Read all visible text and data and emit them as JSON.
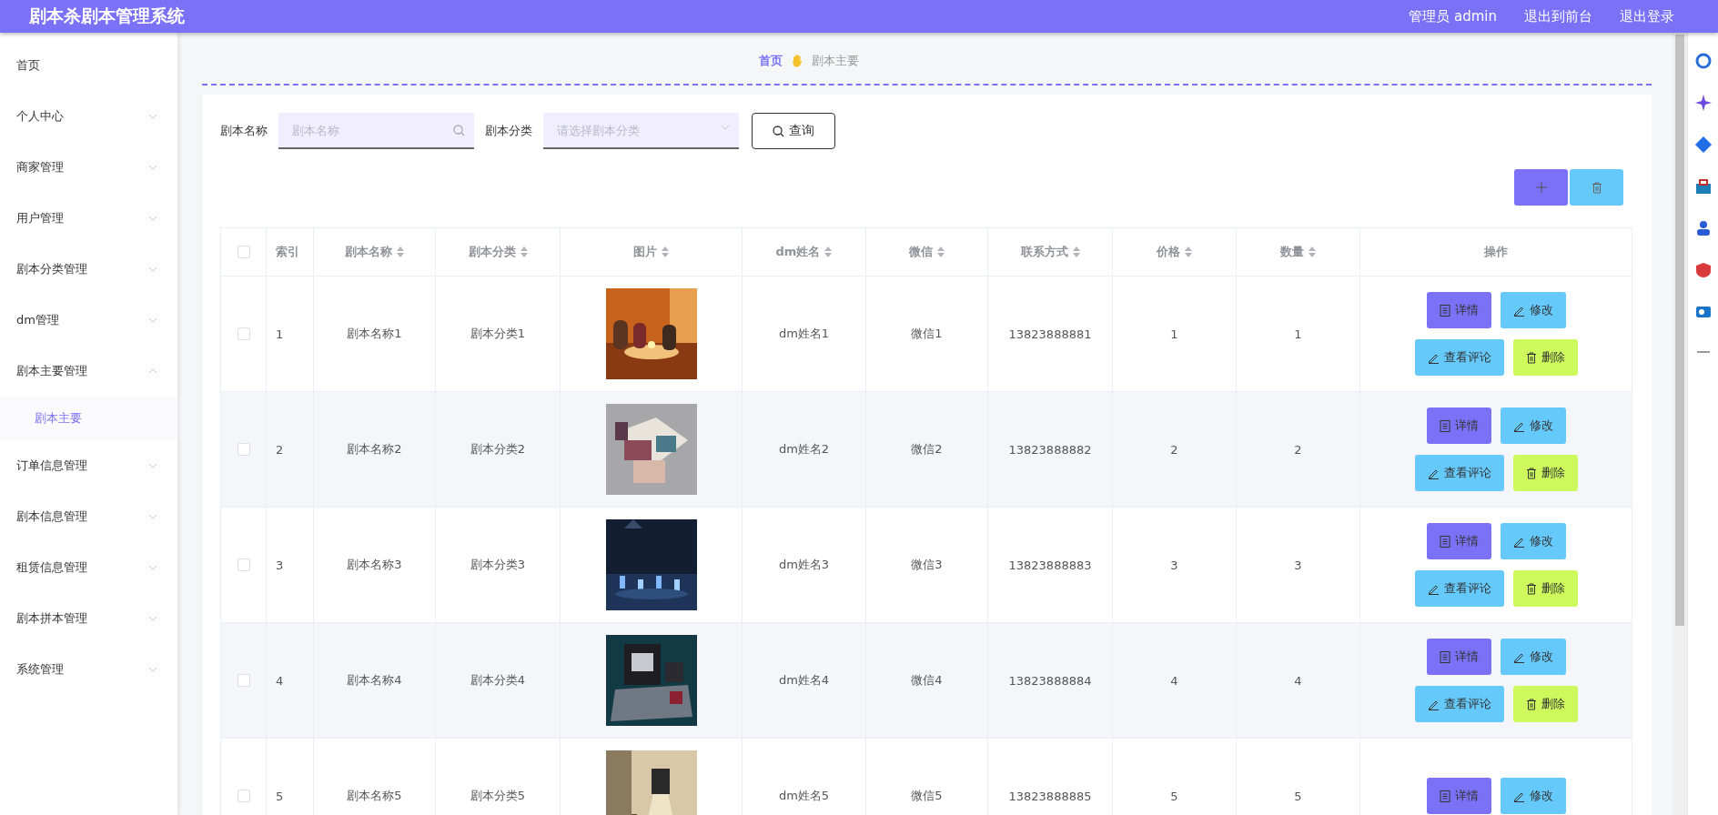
{
  "header": {
    "title": "剧本杀剧本管理系统",
    "links": [
      {
        "label": "管理员 admin"
      },
      {
        "label": "退出到前台"
      },
      {
        "label": "退出登录"
      }
    ]
  },
  "sidebar": {
    "items": [
      {
        "label": "首页",
        "kind": "link"
      },
      {
        "label": "个人中心",
        "kind": "menu",
        "expanded": false
      },
      {
        "label": "商家管理",
        "kind": "menu",
        "expanded": false
      },
      {
        "label": "用户管理",
        "kind": "menu",
        "expanded": false
      },
      {
        "label": "剧本分类管理",
        "kind": "menu",
        "expanded": false
      },
      {
        "label": "dm管理",
        "kind": "menu",
        "expanded": false
      },
      {
        "label": "剧本主要管理",
        "kind": "menu",
        "expanded": true,
        "children": [
          {
            "label": "剧本主要",
            "selected": true
          }
        ]
      },
      {
        "label": "订单信息管理",
        "kind": "menu",
        "expanded": false
      },
      {
        "label": "剧本信息管理",
        "kind": "menu",
        "expanded": false
      },
      {
        "label": "租赁信息管理",
        "kind": "menu",
        "expanded": false
      },
      {
        "label": "剧本拼本管理",
        "kind": "menu",
        "expanded": false
      },
      {
        "label": "系统管理",
        "kind": "menu",
        "expanded": false
      }
    ]
  },
  "breadcrumb": [
    {
      "label": "首页",
      "selected": false
    },
    {
      "label": "剧本主要",
      "selected": true
    }
  ],
  "search": {
    "fields": [
      {
        "label": "剧本名称",
        "placeholder": "剧本名称",
        "kind": "text"
      },
      {
        "label": "剧本分类",
        "placeholder": "请选择剧本分类",
        "kind": "select"
      }
    ],
    "button": "查询"
  },
  "table": {
    "select_all": {
      "checked": false
    },
    "columns": [
      {
        "label": "索引",
        "sortable": false
      },
      {
        "label": "剧本名称",
        "sortable": true
      },
      {
        "label": "剧本分类",
        "sortable": true
      },
      {
        "label": "图片",
        "sortable": true
      },
      {
        "label": "dm姓名",
        "sortable": true
      },
      {
        "label": "微信",
        "sortable": true
      },
      {
        "label": "联系方式",
        "sortable": true
      },
      {
        "label": "价格",
        "sortable": true
      },
      {
        "label": "数量",
        "sortable": true
      },
      {
        "label": "操作",
        "sortable": false
      }
    ],
    "rows": [
      {
        "checked": false,
        "cells": [
          "1",
          "剧本名称1",
          "剧本分类1",
          {
            "kind": "picture"
          },
          "dm姓名1",
          "微信1",
          "13823888881",
          "1",
          "1"
        ],
        "actions": [
          {
            "label": "详情",
            "kind": "detail"
          },
          {
            "label": "修改",
            "kind": "edit"
          },
          {
            "label": "查看评论",
            "kind": "comment"
          },
          {
            "label": "删除",
            "kind": "delete"
          }
        ]
      },
      {
        "checked": false,
        "cells": [
          "2",
          "剧本名称2",
          "剧本分类2",
          {
            "kind": "picture"
          },
          "dm姓名2",
          "微信2",
          "13823888882",
          "2",
          "2"
        ],
        "actions": [
          {
            "label": "详情",
            "kind": "detail"
          },
          {
            "label": "修改",
            "kind": "edit"
          },
          {
            "label": "查看评论",
            "kind": "comment"
          },
          {
            "label": "删除",
            "kind": "delete"
          }
        ]
      },
      {
        "checked": false,
        "cells": [
          "3",
          "剧本名称3",
          "剧本分类3",
          {
            "kind": "picture"
          },
          "dm姓名3",
          "微信3",
          "13823888883",
          "3",
          "3"
        ],
        "actions": [
          {
            "label": "详情",
            "kind": "detail"
          },
          {
            "label": "修改",
            "kind": "edit"
          },
          {
            "label": "查看评论",
            "kind": "comment"
          },
          {
            "label": "删除",
            "kind": "delete"
          }
        ]
      },
      {
        "checked": false,
        "cells": [
          "4",
          "剧本名称4",
          "剧本分类4",
          {
            "kind": "picture"
          },
          "dm姓名4",
          "微信4",
          "13823888884",
          "4",
          "4"
        ],
        "actions": [
          {
            "label": "详情",
            "kind": "detail"
          },
          {
            "label": "修改",
            "kind": "edit"
          },
          {
            "label": "查看评论",
            "kind": "comment"
          },
          {
            "label": "删除",
            "kind": "delete"
          }
        ]
      },
      {
        "checked": false,
        "cells": [
          "5",
          "剧本名称5",
          "剧本分类5",
          {
            "kind": "picture"
          },
          "dm姓名5",
          "微信5",
          "13823888885",
          "5",
          "5"
        ],
        "actions": [
          {
            "label": "详情",
            "kind": "detail"
          },
          {
            "label": "修改",
            "kind": "edit"
          }
        ]
      }
    ]
  }
}
